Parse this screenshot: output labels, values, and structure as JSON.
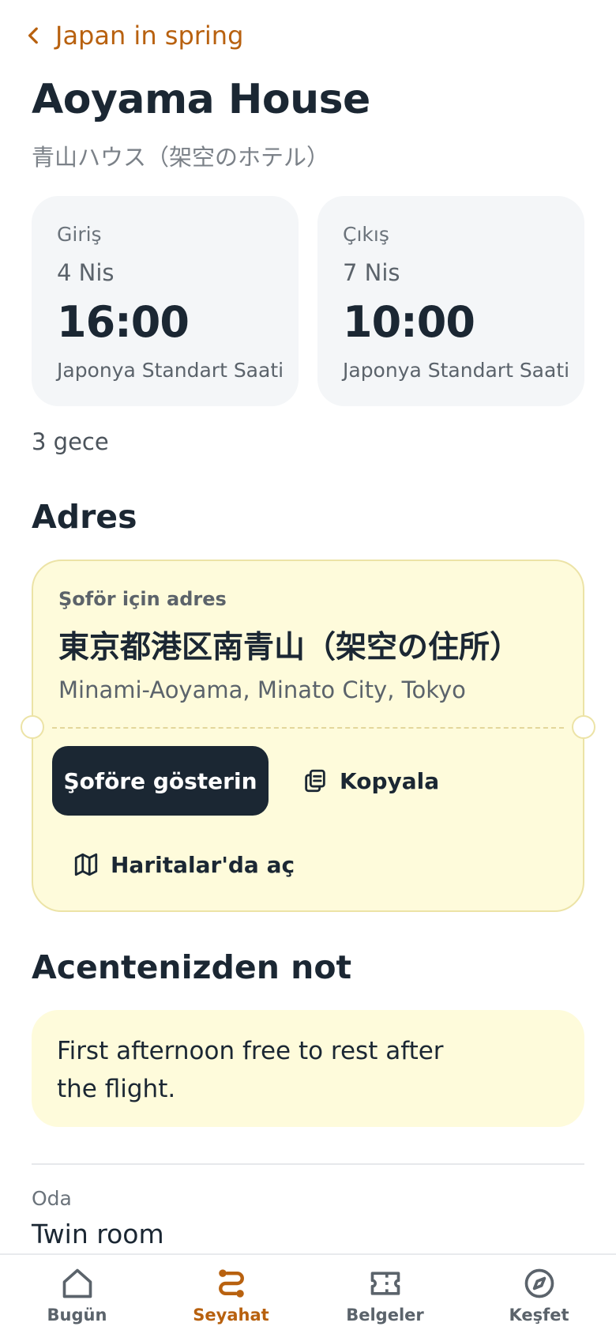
{
  "header": {
    "back_label": "Japan in spring",
    "title": "Aoyama House",
    "subtitle": "青山ハウス（架空のホテル）"
  },
  "checkin": {
    "label": "Giriş",
    "date": "4 Nis",
    "time": "16:00",
    "timezone": "Japonya Standart Saati"
  },
  "checkout": {
    "label": "Çıkış",
    "date": "7 Nis",
    "time": "10:00",
    "timezone": "Japonya Standart Saati"
  },
  "nights": "3 gece",
  "address": {
    "heading": "Adres",
    "driver_label": "Şoför için adres",
    "japanese": "東京都港区南青山（架空の住所）",
    "romaji": "Minami-Aoyama, Minato City, Tokyo",
    "show_button": "Şoföre gösterin",
    "copy_button": "Kopyala",
    "maps_button": "Haritalar'da aç"
  },
  "agent_note": {
    "heading": "Acentenizden not",
    "text": "First afternoon free to rest after the flight."
  },
  "room": {
    "label": "Oda",
    "value": "Twin room"
  },
  "tabbar": {
    "items": [
      {
        "label": "Bugün",
        "icon": "home-icon"
      },
      {
        "label": "Seyahat",
        "icon": "route-icon",
        "active": true
      },
      {
        "label": "Belgeler",
        "icon": "ticket-icon"
      },
      {
        "label": "Keşfet",
        "icon": "compass-icon"
      }
    ]
  },
  "colors": {
    "accent": "#b8610f",
    "ink": "#1b2733",
    "address_card_bg": "#fefbdb",
    "time_card_bg": "#f4f6f8"
  }
}
